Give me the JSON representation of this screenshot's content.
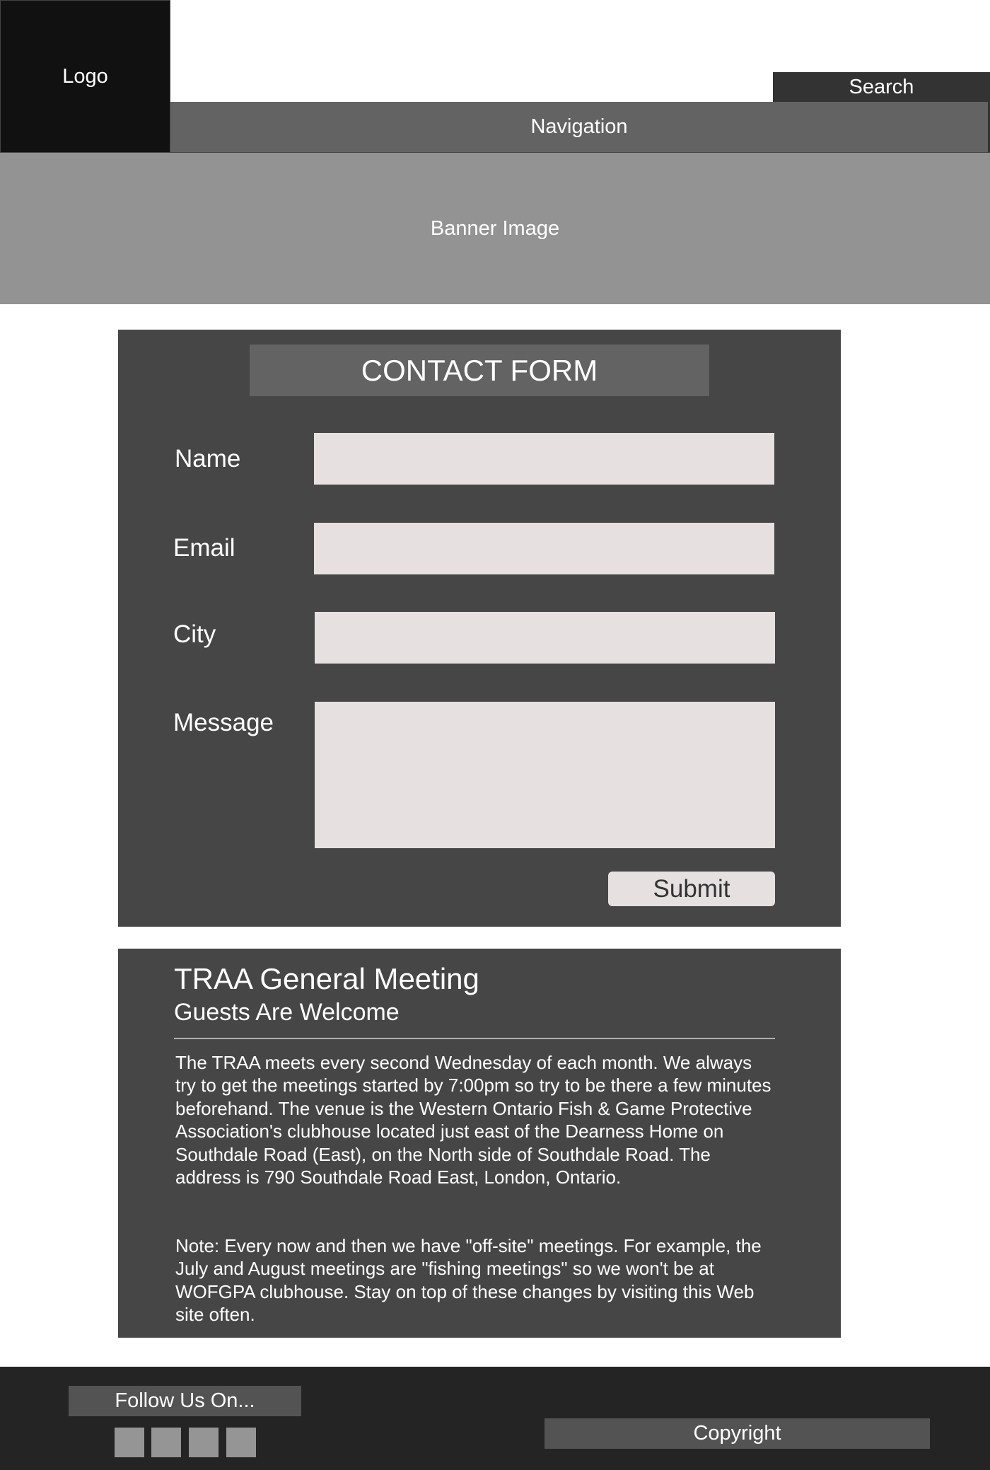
{
  "header": {
    "logo": "Logo",
    "search": "Search",
    "navigation": "Navigation"
  },
  "banner": {
    "label": "Banner Image"
  },
  "contact_form": {
    "title": "CONTACT FORM",
    "fields": [
      {
        "label": "Name",
        "value": ""
      },
      {
        "label": "Email",
        "value": ""
      },
      {
        "label": "City",
        "value": ""
      },
      {
        "label": "Message",
        "value": ""
      }
    ],
    "submit_label": "Submit"
  },
  "meeting": {
    "title": "TRAA General Meeting",
    "subtitle": "Guests Are Welcome",
    "paragraph1": "The TRAA meets every second Wednesday of each month. We always try to get the meetings started by 7:00pm so try to be there a few minutes beforehand. The venue is the Western Ontario Fish & Game Protective Association's clubhouse located just east of the Dearness Home on Southdale Road (East), on the North side of Southdale Road. The address is 790 Southdale Road East, London, Ontario.",
    "paragraph2": "Note: Every now and then we have \"off-site\" meetings. For example, the July and August meetings are \"fishing meetings\" so we won't be at WOFGPA clubhouse. Stay on top of these changes by visiting this Web site often."
  },
  "footer": {
    "follow_label": "Follow Us On...",
    "social_icons": [
      "social-icon",
      "social-icon",
      "social-icon",
      "social-icon"
    ],
    "copyright": "Copyright"
  }
}
